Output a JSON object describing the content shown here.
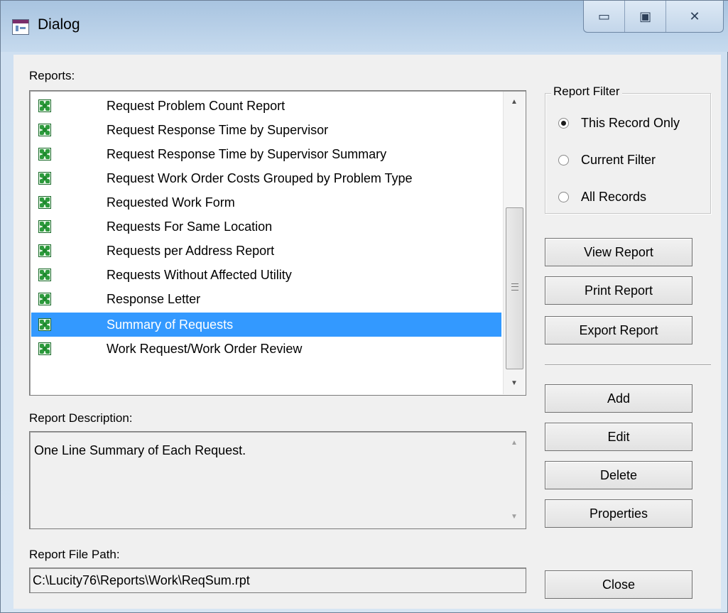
{
  "window": {
    "title": "Dialog",
    "controls": {
      "minimize": "▭",
      "maximize": "▣",
      "close": "✕"
    }
  },
  "reports": {
    "label": "Reports:",
    "items": [
      {
        "label": "Request Problem Count Report"
      },
      {
        "label": "Request Response Time by Supervisor"
      },
      {
        "label": "Request Response Time by Supervisor Summary"
      },
      {
        "label": "Request Work Order Costs Grouped by Problem Type"
      },
      {
        "label": "Requested Work Form"
      },
      {
        "label": "Requests For Same Location"
      },
      {
        "label": "Requests per Address Report"
      },
      {
        "label": "Requests Without Affected Utility"
      },
      {
        "label": "Response Letter"
      },
      {
        "label": "Summary of Requests"
      },
      {
        "label": "Work Request/Work Order Review"
      }
    ],
    "selected_index": 9,
    "icon": "report-icon"
  },
  "description": {
    "label": "Report Description:",
    "value": "One Line Summary of Each Request."
  },
  "file_path": {
    "label": "Report File Path:",
    "value": "C:\\Lucity76\\Reports\\Work\\ReqSum.rpt"
  },
  "filter": {
    "title": "Report Filter",
    "options": [
      {
        "label": "This Record Only",
        "checked": true
      },
      {
        "label": "Current Filter",
        "checked": false
      },
      {
        "label": "All Records",
        "checked": false
      }
    ]
  },
  "buttons": {
    "view": "View Report",
    "print": "Print Report",
    "export": "Export Report",
    "add": "Add",
    "edit": "Edit",
    "delete": "Delete",
    "properties": "Properties",
    "close": "Close"
  },
  "colors": {
    "selection": "#3399ff",
    "dialog_bg": "#f0f0f0"
  }
}
